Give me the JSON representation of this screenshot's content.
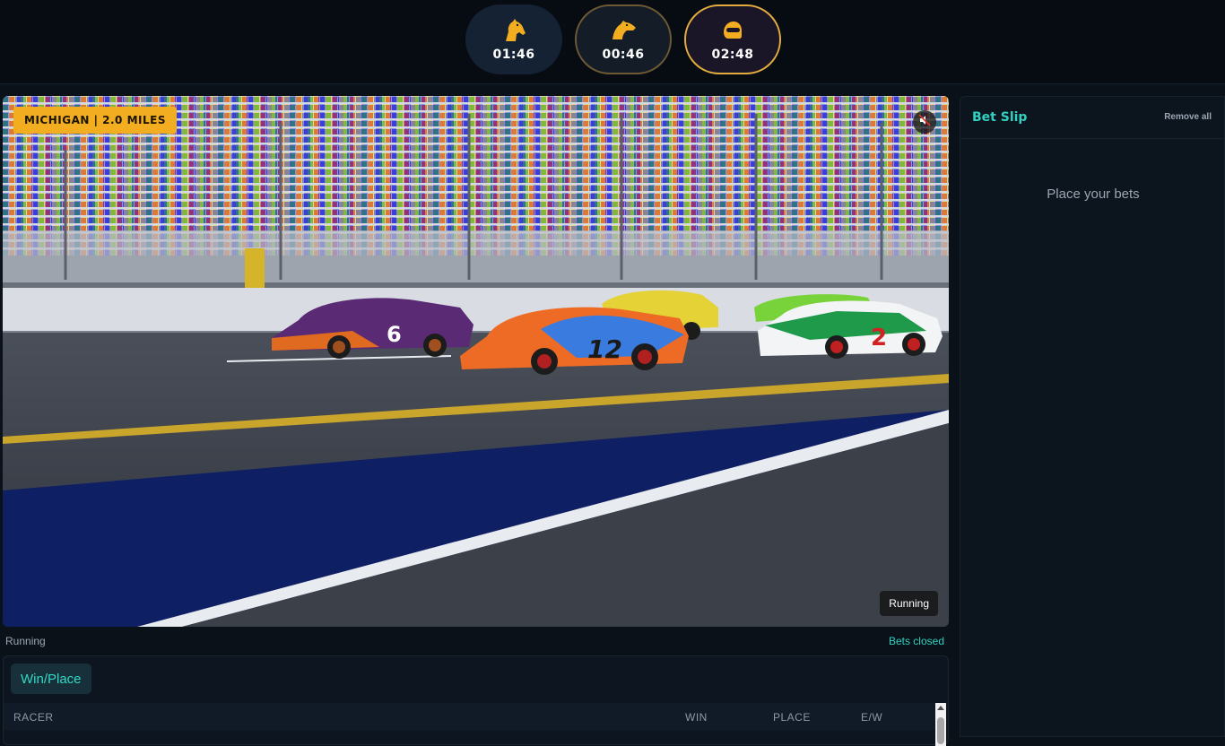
{
  "race_tabs": [
    {
      "sport": "horse-racing",
      "icon": "horse-head-icon",
      "countdown": "01:46"
    },
    {
      "sport": "greyhound-racing",
      "icon": "greyhound-head-icon",
      "countdown": "00:46"
    },
    {
      "sport": "motor-racing",
      "icon": "racing-helmet-icon",
      "countdown": "02:48"
    }
  ],
  "video": {
    "track_label": "MICHIGAN | 2.0 MILES",
    "status": "Running",
    "mute_icon": "speaker-muted-icon"
  },
  "status_row": {
    "race_status": "Running",
    "bets_status": "Bets closed"
  },
  "bet_panel": {
    "active_tab": "Win/Place",
    "columns": [
      "RACER",
      "WIN",
      "PLACE",
      "E/W"
    ]
  },
  "bet_slip": {
    "title": "Bet Slip",
    "remove_all": "Remove all",
    "empty_message": "Place your bets"
  },
  "colors": {
    "accent": "#2fd2c0",
    "gold": "#f2ad20",
    "background": "#0b1119"
  }
}
